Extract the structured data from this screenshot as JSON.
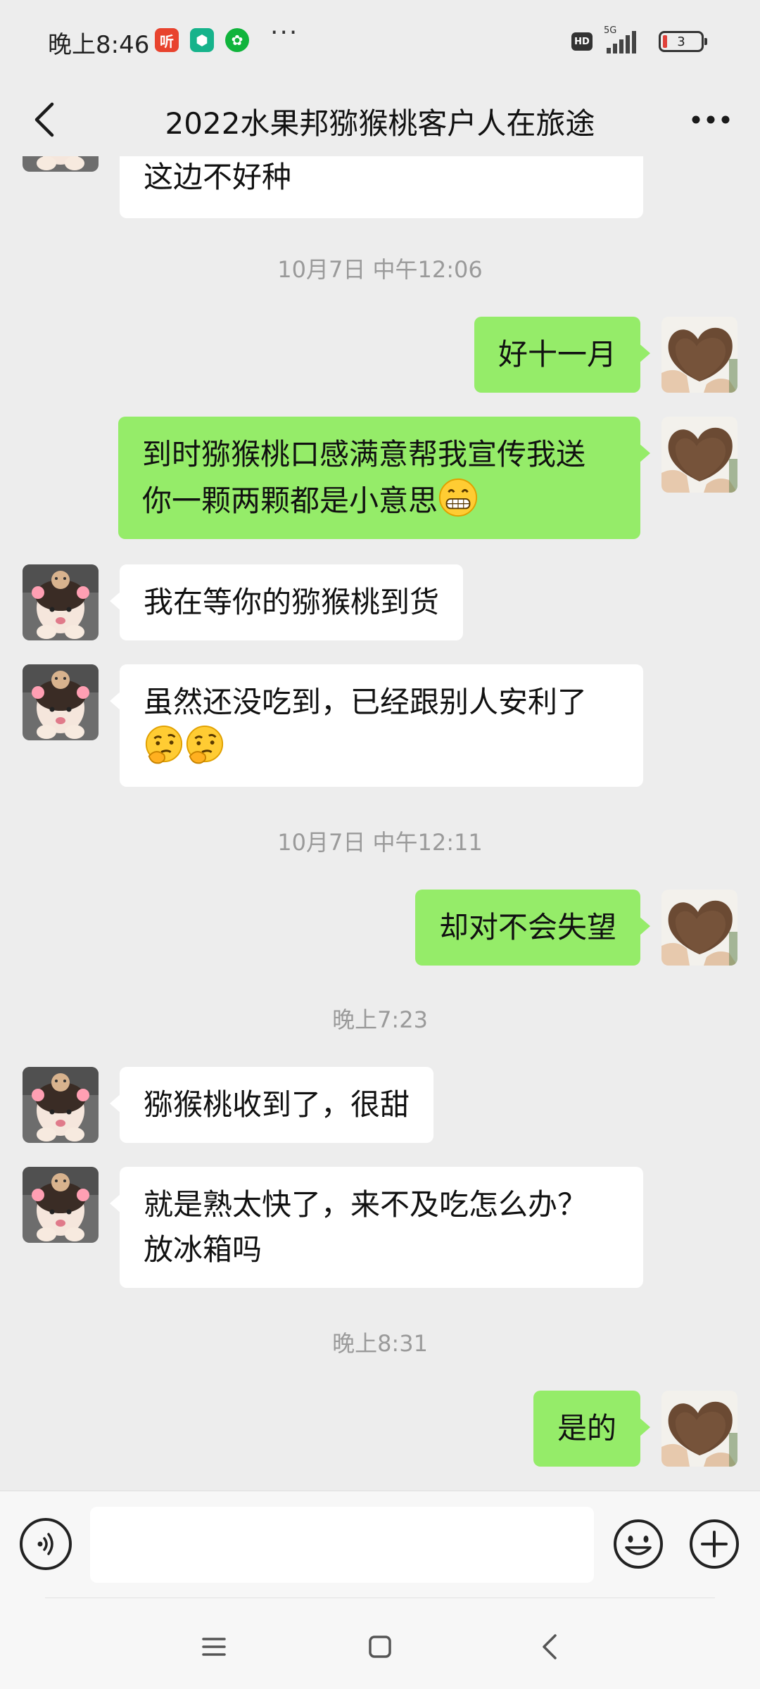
{
  "status_bar": {
    "time": "晚上8:46",
    "apps": [
      "听",
      "⬢",
      "✿"
    ],
    "more": "···",
    "hd": "HD",
    "network": "5G",
    "battery": "3",
    "icons": [
      "ting-app-icon",
      "shield-app-icon",
      "wechat-sport-icon",
      "hd-icon",
      "signal-icon",
      "battery-icon"
    ]
  },
  "header": {
    "title": "2022水果邦猕猴桃客户人在旅途",
    "back_icon": "chevron-left-icon",
    "more_icon": "more-icon"
  },
  "messages": [
    {
      "type": "msg",
      "from": "them",
      "text": "这边不好种"
    },
    {
      "type": "time",
      "text": "10月7日 中午12:06"
    },
    {
      "type": "msg",
      "from": "me",
      "text": "好十一月"
    },
    {
      "type": "msg",
      "from": "me",
      "line1": "到时猕猴桃口感满意帮我宣传我送",
      "line2": "你一颗两颗都是小意思",
      "emoji": "grin-emoji"
    },
    {
      "type": "msg",
      "from": "them",
      "text": "我在等你的猕猴桃到货"
    },
    {
      "type": "msg",
      "from": "them",
      "text": "虽然还没吃到，已经跟别人安利了",
      "emoji": "thinking-emoji"
    },
    {
      "type": "time",
      "text": "10月7日 中午12:11"
    },
    {
      "type": "msg",
      "from": "me",
      "text": "却对不会失望"
    },
    {
      "type": "time",
      "text": "晚上7:23"
    },
    {
      "type": "msg",
      "from": "them",
      "text": "猕猴桃收到了，很甜"
    },
    {
      "type": "msg",
      "from": "them",
      "line1": "就是熟太快了，来不及吃怎么办？",
      "line2": "放冰箱吗"
    },
    {
      "type": "time",
      "text": "晚上8:31"
    },
    {
      "type": "msg",
      "from": "me",
      "text": "是的"
    }
  ],
  "input_bar": {
    "placeholder": "",
    "icons": [
      "voice-icon",
      "emoji-icon",
      "plus-icon"
    ]
  },
  "nav_bar": {
    "icons": [
      "menu-icon",
      "home-icon",
      "back-icon"
    ]
  },
  "colors": {
    "background": "#ededed",
    "my_bubble": "#95ec69",
    "their_bubble": "#ffffff",
    "timestamp": "#9a9a9a"
  }
}
